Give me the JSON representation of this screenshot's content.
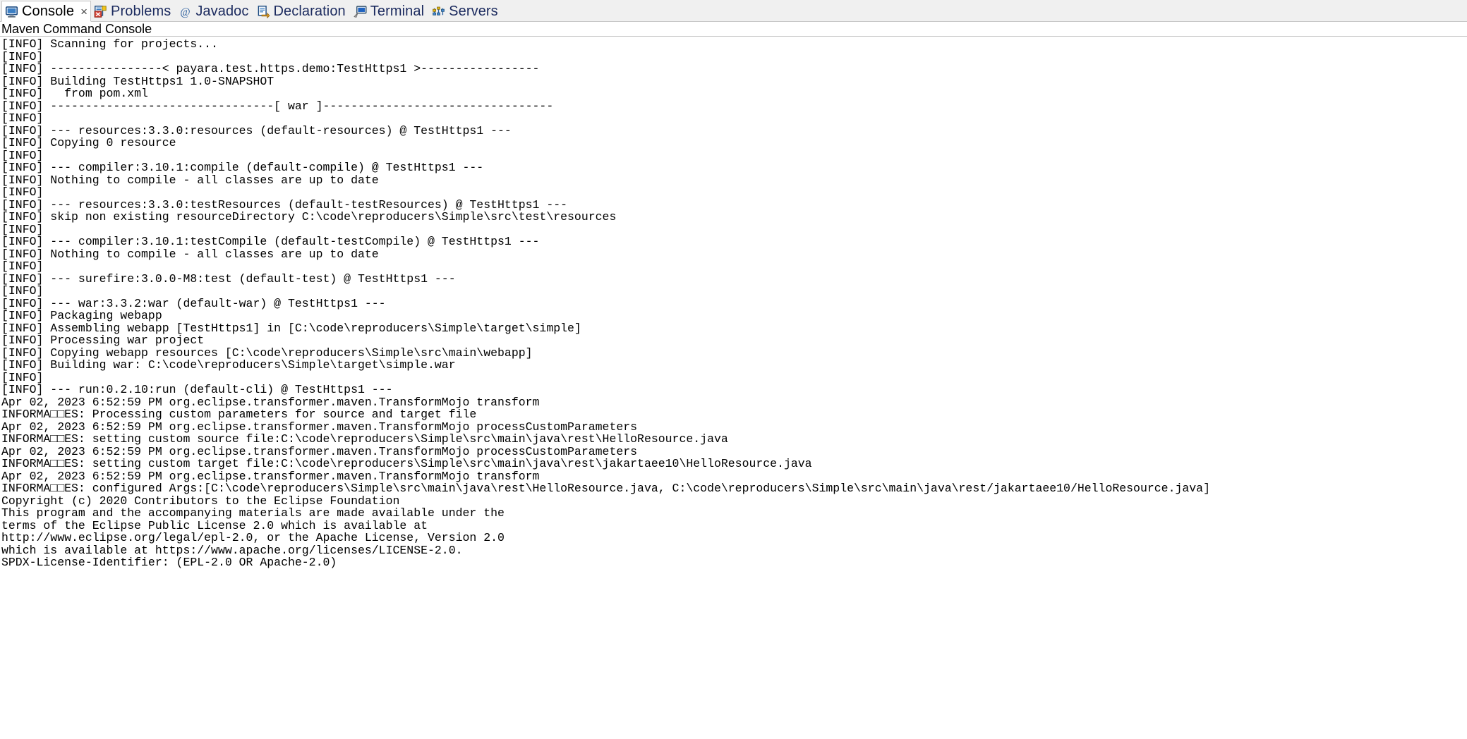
{
  "window": {
    "view_title": "Maven Command Console",
    "background": "#ffffff",
    "tab_bar_background": "#f0f0f0",
    "text_color": "#000000",
    "active_tab_text_color": "#000000",
    "inactive_tab_text_color": "#1b2a5e"
  },
  "tabs": [
    {
      "label": "Console",
      "icon": "console-monitor-icon",
      "active": true,
      "closable": true,
      "close_glyph": "×"
    },
    {
      "label": "Problems",
      "icon": "problems-error-icon",
      "active": false,
      "closable": false,
      "close_glyph": ""
    },
    {
      "label": "Javadoc",
      "icon": "javadoc-at-icon",
      "active": false,
      "closable": false,
      "close_glyph": ""
    },
    {
      "label": "Declaration",
      "icon": "declaration-doc-icon",
      "active": false,
      "closable": false,
      "close_glyph": ""
    },
    {
      "label": "Terminal",
      "icon": "terminal-icon",
      "active": false,
      "closable": false,
      "close_glyph": ""
    },
    {
      "label": "Servers",
      "icon": "servers-icon",
      "active": false,
      "closable": false,
      "close_glyph": ""
    }
  ],
  "console": {
    "lines": [
      "[INFO] Scanning for projects...",
      "[INFO] ",
      "[INFO] ----------------< payara.test.https.demo:TestHttps1 >-----------------",
      "[INFO] Building TestHttps1 1.0-SNAPSHOT",
      "[INFO]   from pom.xml",
      "[INFO] --------------------------------[ war ]---------------------------------",
      "[INFO] ",
      "[INFO] --- resources:3.3.0:resources (default-resources) @ TestHttps1 ---",
      "[INFO] Copying 0 resource",
      "[INFO] ",
      "[INFO] --- compiler:3.10.1:compile (default-compile) @ TestHttps1 ---",
      "[INFO] Nothing to compile - all classes are up to date",
      "[INFO] ",
      "[INFO] --- resources:3.3.0:testResources (default-testResources) @ TestHttps1 ---",
      "[INFO] skip non existing resourceDirectory C:\\code\\reproducers\\Simple\\src\\test\\resources",
      "[INFO] ",
      "[INFO] --- compiler:3.10.1:testCompile (default-testCompile) @ TestHttps1 ---",
      "[INFO] Nothing to compile - all classes are up to date",
      "[INFO] ",
      "[INFO] --- surefire:3.0.0-M8:test (default-test) @ TestHttps1 ---",
      "[INFO] ",
      "[INFO] --- war:3.3.2:war (default-war) @ TestHttps1 ---",
      "[INFO] Packaging webapp",
      "[INFO] Assembling webapp [TestHttps1] in [C:\\code\\reproducers\\Simple\\target\\simple]",
      "[INFO] Processing war project",
      "[INFO] Copying webapp resources [C:\\code\\reproducers\\Simple\\src\\main\\webapp]",
      "[INFO] Building war: C:\\code\\reproducers\\Simple\\target\\simple.war",
      "[INFO] ",
      "[INFO] --- run:0.2.10:run (default-cli) @ TestHttps1 ---",
      "Apr 02, 2023 6:52:59 PM org.eclipse.transformer.maven.TransformMojo transform",
      "INFORMA□□ES: Processing custom parameters for source and target file",
      "Apr 02, 2023 6:52:59 PM org.eclipse.transformer.maven.TransformMojo processCustomParameters",
      "INFORMA□□ES: setting custom source file:C:\\code\\reproducers\\Simple\\src\\main\\java\\rest\\HelloResource.java",
      "Apr 02, 2023 6:52:59 PM org.eclipse.transformer.maven.TransformMojo processCustomParameters",
      "INFORMA□□ES: setting custom target file:C:\\code\\reproducers\\Simple\\src\\main\\java\\rest\\jakartaee10\\HelloResource.java",
      "Apr 02, 2023 6:52:59 PM org.eclipse.transformer.maven.TransformMojo transform",
      "INFORMA□□ES: configured Args:[C:\\code\\reproducers\\Simple\\src\\main\\java\\rest\\HelloResource.java, C:\\code\\reproducers\\Simple\\src\\main\\java\\rest/jakartaee10/HelloResource.java]",
      "Copyright (c) 2020 Contributors to the Eclipse Foundation",
      "This program and the accompanying materials are made available under the",
      "terms of the Eclipse Public License 2.0 which is available at",
      "http://www.eclipse.org/legal/epl-2.0, or the Apache License, Version 2.0",
      "which is available at https://www.apache.org/licenses/LICENSE-2.0.",
      "SPDX-License-Identifier: (EPL-2.0 OR Apache-2.0)"
    ]
  }
}
